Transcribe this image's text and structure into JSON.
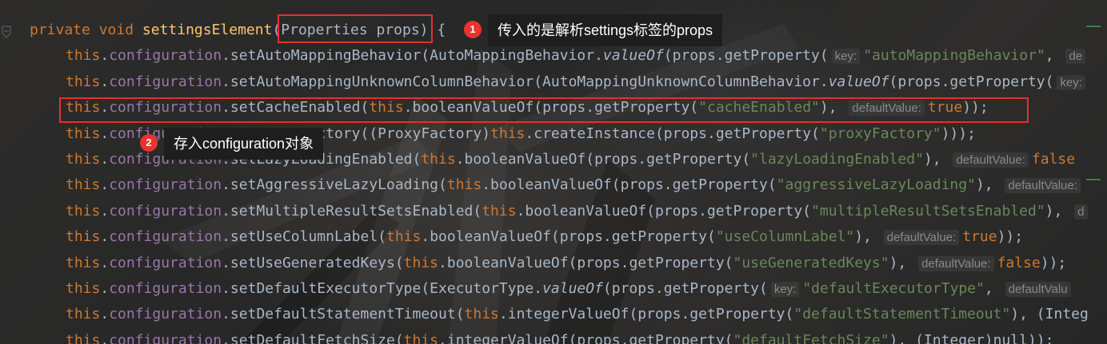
{
  "editor": {
    "lines": [
      [
        {
          "t": "private void ",
          "c": "kw"
        },
        {
          "t": "settingsElement",
          "c": "fn"
        },
        {
          "t": "(Properties props) {",
          "c": "p"
        }
      ],
      [
        {
          "t": "this",
          "c": "kw"
        },
        {
          "t": ".",
          "c": "p"
        },
        {
          "t": "configuration",
          "c": "fld"
        },
        {
          "t": ".setAutoMappingBehavior(AutoMappingBehavior.",
          "c": "p"
        },
        {
          "t": "valueOf",
          "c": "it"
        },
        {
          "t": "(props.getProperty(",
          "c": "p"
        },
        {
          "t": "key:",
          "c": "hint"
        },
        {
          "t": "\"autoMappingBehavior\"",
          "c": "str"
        },
        {
          "t": ", ",
          "c": "p"
        },
        {
          "t": "de",
          "c": "hint"
        }
      ],
      [
        {
          "t": "this",
          "c": "kw"
        },
        {
          "t": ".",
          "c": "p"
        },
        {
          "t": "configuration",
          "c": "fld"
        },
        {
          "t": ".setAutoMappingUnknownColumnBehavior(AutoMappingUnknownColumnBehavior.",
          "c": "p"
        },
        {
          "t": "valueOf",
          "c": "it"
        },
        {
          "t": "(props.getProperty(",
          "c": "p"
        },
        {
          "t": "key:",
          "c": "hint"
        }
      ],
      [
        {
          "t": "this",
          "c": "kw"
        },
        {
          "t": ".",
          "c": "p"
        },
        {
          "t": "configuration",
          "c": "fld"
        },
        {
          "t": ".setCacheEnabled(",
          "c": "p"
        },
        {
          "t": "this",
          "c": "kw"
        },
        {
          "t": ".booleanValueOf(props.getProperty(",
          "c": "p"
        },
        {
          "t": "\"cacheEnabled\"",
          "c": "str"
        },
        {
          "t": "), ",
          "c": "p"
        },
        {
          "t": "defaultValue:",
          "c": "hint"
        },
        {
          "t": "true",
          "c": "kw"
        },
        {
          "t": "));",
          "c": "p"
        }
      ],
      [
        {
          "t": "this",
          "c": "kw"
        },
        {
          "t": ".",
          "c": "p"
        },
        {
          "t": "configuration",
          "c": "fld"
        },
        {
          "t": ".setProxyFactory((ProxyFactory)",
          "c": "p"
        },
        {
          "t": "this",
          "c": "kw"
        },
        {
          "t": ".createInstance(props.getProperty(",
          "c": "p"
        },
        {
          "t": "\"proxyFactory\"",
          "c": "str"
        },
        {
          "t": ")));",
          "c": "p"
        }
      ],
      [
        {
          "t": "this",
          "c": "kw"
        },
        {
          "t": ".",
          "c": "p"
        },
        {
          "t": "configuration",
          "c": "fld"
        },
        {
          "t": ".setLazyLoadingEnabled(",
          "c": "p"
        },
        {
          "t": "this",
          "c": "kw"
        },
        {
          "t": ".booleanValueOf(props.getProperty(",
          "c": "p"
        },
        {
          "t": "\"lazyLoadingEnabled\"",
          "c": "str"
        },
        {
          "t": "), ",
          "c": "p"
        },
        {
          "t": "defaultValue:",
          "c": "hint"
        },
        {
          "t": "false",
          "c": "kw"
        }
      ],
      [
        {
          "t": "this",
          "c": "kw"
        },
        {
          "t": ".",
          "c": "p"
        },
        {
          "t": "configuration",
          "c": "fld"
        },
        {
          "t": ".setAggressiveLazyLoading(",
          "c": "p"
        },
        {
          "t": "this",
          "c": "kw"
        },
        {
          "t": ".booleanValueOf(props.getProperty(",
          "c": "p"
        },
        {
          "t": "\"aggressiveLazyLoading\"",
          "c": "str"
        },
        {
          "t": "), ",
          "c": "p"
        },
        {
          "t": "defaultValue:",
          "c": "hint"
        }
      ],
      [
        {
          "t": "this",
          "c": "kw"
        },
        {
          "t": ".",
          "c": "p"
        },
        {
          "t": "configuration",
          "c": "fld"
        },
        {
          "t": ".setMultipleResultSetsEnabled(",
          "c": "p"
        },
        {
          "t": "this",
          "c": "kw"
        },
        {
          "t": ".booleanValueOf(props.getProperty(",
          "c": "p"
        },
        {
          "t": "\"multipleResultSetsEnabled\"",
          "c": "str"
        },
        {
          "t": "), ",
          "c": "p"
        },
        {
          "t": "d",
          "c": "hint"
        }
      ],
      [
        {
          "t": "this",
          "c": "kw"
        },
        {
          "t": ".",
          "c": "p"
        },
        {
          "t": "configuration",
          "c": "fld"
        },
        {
          "t": ".setUseColumnLabel(",
          "c": "p"
        },
        {
          "t": "this",
          "c": "kw"
        },
        {
          "t": ".booleanValueOf(props.getProperty(",
          "c": "p"
        },
        {
          "t": "\"useColumnLabel\"",
          "c": "str"
        },
        {
          "t": "), ",
          "c": "p"
        },
        {
          "t": "defaultValue:",
          "c": "hint"
        },
        {
          "t": "true",
          "c": "kw"
        },
        {
          "t": "));",
          "c": "p"
        }
      ],
      [
        {
          "t": "this",
          "c": "kw"
        },
        {
          "t": ".",
          "c": "p"
        },
        {
          "t": "configuration",
          "c": "fld"
        },
        {
          "t": ".setUseGeneratedKeys(",
          "c": "p"
        },
        {
          "t": "this",
          "c": "kw"
        },
        {
          "t": ".booleanValueOf(props.getProperty(",
          "c": "p"
        },
        {
          "t": "\"useGeneratedKeys\"",
          "c": "str"
        },
        {
          "t": "), ",
          "c": "p"
        },
        {
          "t": "defaultValue:",
          "c": "hint"
        },
        {
          "t": "false",
          "c": "kw"
        },
        {
          "t": "));",
          "c": "p"
        }
      ],
      [
        {
          "t": "this",
          "c": "kw"
        },
        {
          "t": ".",
          "c": "p"
        },
        {
          "t": "configuration",
          "c": "fld"
        },
        {
          "t": ".setDefaultExecutorType(ExecutorType.",
          "c": "p"
        },
        {
          "t": "valueOf",
          "c": "it"
        },
        {
          "t": "(props.getProperty(",
          "c": "p"
        },
        {
          "t": "key:",
          "c": "hint"
        },
        {
          "t": "\"defaultExecutorType\"",
          "c": "str"
        },
        {
          "t": ", ",
          "c": "p"
        },
        {
          "t": "defaultValu",
          "c": "hint"
        }
      ],
      [
        {
          "t": "this",
          "c": "kw"
        },
        {
          "t": ".",
          "c": "p"
        },
        {
          "t": "configuration",
          "c": "fld"
        },
        {
          "t": ".setDefaultStatementTimeout(",
          "c": "p"
        },
        {
          "t": "this",
          "c": "kw"
        },
        {
          "t": ".integerValueOf(props.getProperty(",
          "c": "p"
        },
        {
          "t": "\"defaultStatementTimeout\"",
          "c": "str"
        },
        {
          "t": "), (Integ",
          "c": "p"
        }
      ],
      [
        {
          "t": "this",
          "c": "kw"
        },
        {
          "t": ".",
          "c": "p"
        },
        {
          "t": "configuration",
          "c": "fld"
        },
        {
          "t": ".setDefaultFetchSize(",
          "c": "p"
        },
        {
          "t": "this",
          "c": "kw"
        },
        {
          "t": ".integerValueOf(props.getProperty(",
          "c": "p"
        },
        {
          "t": "\"defaultFetchSize\"",
          "c": "str"
        },
        {
          "t": "), (Integer)null));",
          "c": "p"
        }
      ]
    ]
  },
  "annotations": {
    "badge1": "1",
    "callout1": "传入的是解析settings标签的props",
    "badge2": "2",
    "callout2": "存入configuration对象"
  },
  "colors": {
    "keyword": "#cc7832",
    "field": "#9876aa",
    "method_decl": "#ffc66d",
    "string": "#6a8759",
    "plain": "#a9b7c6",
    "highlight_box": "#e0332f",
    "badge": "#e8332f"
  }
}
